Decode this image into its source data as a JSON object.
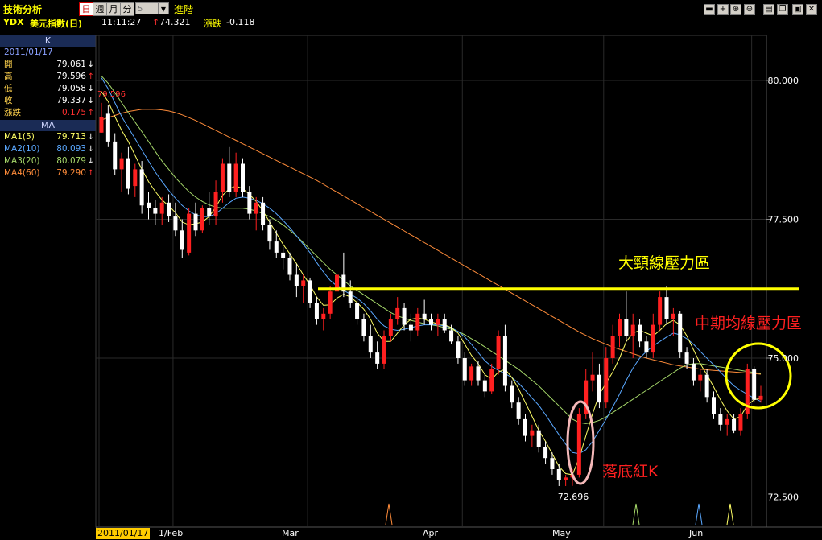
{
  "window": {
    "title": "技術分析",
    "period_buttons": [
      "日",
      "週",
      "月",
      "分"
    ],
    "period_select_value": "5",
    "advanced_label": "進階",
    "controls": [
      "minimize",
      "plus",
      "zoom-in",
      "zoom-out",
      "screenshot",
      "restore",
      "close"
    ]
  },
  "infobar": {
    "code": "YDX",
    "name": "美元指數(日)",
    "time": "11:11:27",
    "price_arrow": "↑",
    "price": "74.321",
    "change_label": "漲跌",
    "change": "-0.118"
  },
  "panel": {
    "k_header": "K",
    "date": "2011/01/17",
    "rows": [
      {
        "label": "開",
        "value": "79.061",
        "arrow": "↓",
        "color": "#ffffff"
      },
      {
        "label": "高",
        "value": "79.596",
        "arrow": "↑",
        "color": "#ffffff"
      },
      {
        "label": "低",
        "value": "79.058",
        "arrow": "↓",
        "color": "#ffffff"
      },
      {
        "label": "收",
        "value": "79.337",
        "arrow": "↓",
        "color": "#ffffff"
      },
      {
        "label": "漲跌",
        "value": "0.175",
        "arrow": "↑",
        "color": "#ff3030"
      }
    ],
    "ma_header": "MA",
    "ma_rows": [
      {
        "label": "MA1(5)",
        "value": "79.713",
        "arrow": "↓",
        "color": "#ffff66"
      },
      {
        "label": "MA2(10)",
        "value": "80.093",
        "arrow": "↓",
        "color": "#5aa8ff"
      },
      {
        "label": "MA3(20)",
        "value": "80.079",
        "arrow": "↓",
        "color": "#a6d86a"
      },
      {
        "label": "MA4(60)",
        "value": "79.290",
        "arrow": "↑",
        "color": "#ff8c3a"
      }
    ]
  },
  "annotations": {
    "neckline": "大頸線壓力區",
    "mid_ma": "中期均線壓力區",
    "bottom_red_k": "落底紅K",
    "low_value": "72.696",
    "high_marker_value": "79.596"
  },
  "chart_data": {
    "type": "candlestick",
    "ylim": [
      72.0,
      81.3
    ],
    "y_ticks": [
      72.5,
      75.0,
      77.5,
      80.0
    ],
    "y_tick_labels": [
      "72.500",
      "75.000",
      "77.500",
      "80.000"
    ],
    "x_tick_labels": [
      "2011/01/17",
      "1/Feb",
      "Mar",
      "Apr",
      "May",
      "Jun"
    ],
    "x_tick_index": [
      0,
      11,
      31,
      54,
      75,
      97
    ],
    "colors": {
      "up": "#ff2020",
      "down": "#ffffff",
      "ma5": "#ffff66",
      "ma10": "#5aa8ff",
      "ma20": "#a6d86a",
      "ma60": "#ff8c3a",
      "neckline": "#ffff00"
    },
    "candles": [
      [
        79.061,
        79.596,
        79.058,
        79.337
      ],
      [
        79.4,
        79.55,
        78.8,
        78.9
      ],
      [
        78.9,
        79.05,
        78.3,
        78.4
      ],
      [
        78.4,
        78.7,
        78.0,
        78.6
      ],
      [
        78.6,
        78.8,
        77.95,
        78.05
      ],
      [
        78.1,
        78.5,
        77.9,
        78.4
      ],
      [
        78.4,
        78.55,
        77.6,
        77.75
      ],
      [
        77.8,
        78.0,
        77.5,
        77.7
      ],
      [
        77.7,
        77.85,
        77.4,
        77.6
      ],
      [
        77.6,
        77.9,
        77.4,
        77.8
      ],
      [
        77.8,
        77.95,
        77.45,
        77.55
      ],
      [
        77.55,
        77.8,
        77.2,
        77.3
      ],
      [
        77.3,
        77.5,
        76.8,
        76.95
      ],
      [
        76.9,
        77.7,
        76.85,
        77.6
      ],
      [
        77.6,
        77.8,
        77.2,
        77.3
      ],
      [
        77.3,
        77.75,
        77.25,
        77.7
      ],
      [
        77.7,
        78.0,
        77.4,
        77.55
      ],
      [
        77.55,
        78.2,
        77.4,
        78.0
      ],
      [
        78.0,
        78.6,
        77.8,
        78.5
      ],
      [
        78.5,
        78.8,
        77.9,
        78.0
      ],
      [
        78.0,
        78.7,
        77.9,
        78.5
      ],
      [
        78.5,
        78.6,
        77.9,
        78.0
      ],
      [
        78.0,
        78.1,
        77.5,
        77.6
      ],
      [
        77.6,
        77.9,
        77.3,
        77.8
      ],
      [
        77.8,
        77.9,
        77.3,
        77.4
      ],
      [
        77.4,
        77.5,
        76.95,
        77.1
      ],
      [
        77.1,
        77.3,
        76.8,
        76.9
      ],
      [
        76.9,
        77.0,
        76.6,
        76.8
      ],
      [
        76.8,
        76.9,
        76.4,
        76.5
      ],
      [
        76.5,
        76.7,
        76.1,
        76.3
      ],
      [
        76.3,
        76.5,
        76.0,
        76.4
      ],
      [
        76.4,
        76.45,
        75.9,
        76.0
      ],
      [
        76.0,
        76.1,
        75.6,
        75.7
      ],
      [
        75.7,
        75.9,
        75.5,
        75.8
      ],
      [
        75.8,
        76.3,
        75.7,
        76.2
      ],
      [
        76.2,
        76.7,
        76.0,
        76.5
      ],
      [
        76.5,
        76.9,
        76.1,
        76.2
      ],
      [
        76.2,
        76.4,
        75.9,
        76.0
      ],
      [
        76.0,
        76.1,
        75.6,
        75.7
      ],
      [
        75.7,
        75.8,
        75.3,
        75.4
      ],
      [
        75.4,
        75.6,
        75.0,
        75.1
      ],
      [
        75.1,
        75.3,
        74.8,
        74.9
      ],
      [
        74.9,
        75.5,
        74.8,
        75.4
      ],
      [
        75.4,
        75.8,
        75.3,
        75.7
      ],
      [
        75.7,
        76.1,
        75.6,
        75.9
      ],
      [
        75.9,
        76.0,
        75.5,
        75.6
      ],
      [
        75.6,
        75.8,
        75.3,
        75.5
      ],
      [
        75.5,
        75.9,
        75.4,
        75.8
      ],
      [
        75.8,
        76.05,
        75.6,
        75.7
      ],
      [
        75.7,
        75.8,
        75.5,
        75.6
      ],
      [
        75.6,
        75.8,
        75.4,
        75.7
      ],
      [
        75.7,
        75.8,
        75.45,
        75.5
      ],
      [
        75.5,
        75.6,
        75.25,
        75.3
      ],
      [
        75.3,
        75.4,
        74.9,
        75.0
      ],
      [
        75.0,
        75.1,
        74.5,
        74.6
      ],
      [
        74.6,
        74.9,
        74.5,
        74.85
      ],
      [
        74.85,
        74.95,
        74.5,
        74.6
      ],
      [
        74.6,
        74.7,
        74.3,
        74.4
      ],
      [
        74.4,
        74.9,
        74.35,
        74.8
      ],
      [
        74.8,
        75.5,
        74.7,
        75.4
      ],
      [
        75.4,
        75.6,
        74.4,
        74.5
      ],
      [
        74.5,
        74.6,
        74.1,
        74.2
      ],
      [
        74.2,
        74.3,
        73.8,
        73.9
      ],
      [
        73.9,
        74.0,
        73.5,
        73.6
      ],
      [
        73.6,
        73.8,
        73.4,
        73.7
      ],
      [
        73.7,
        73.8,
        73.3,
        73.4
      ],
      [
        73.4,
        73.5,
        73.1,
        73.2
      ],
      [
        73.2,
        73.3,
        72.9,
        73.0
      ],
      [
        73.0,
        73.1,
        72.696,
        72.8
      ],
      [
        72.8,
        72.9,
        72.696,
        72.85
      ],
      [
        72.85,
        73.0,
        72.7,
        72.9
      ],
      [
        72.9,
        74.1,
        72.85,
        74.0
      ],
      [
        74.0,
        74.8,
        73.9,
        74.6
      ],
      [
        74.6,
        75.1,
        74.4,
        74.7
      ],
      [
        74.7,
        74.9,
        74.1,
        74.2
      ],
      [
        74.2,
        75.2,
        74.1,
        75.0
      ],
      [
        75.0,
        75.6,
        74.9,
        75.4
      ],
      [
        75.4,
        75.8,
        75.2,
        75.7
      ],
      [
        75.7,
        76.2,
        75.3,
        75.4
      ],
      [
        75.4,
        75.8,
        75.0,
        75.6
      ],
      [
        75.6,
        75.7,
        75.2,
        75.3
      ],
      [
        75.3,
        75.4,
        75.0,
        75.1
      ],
      [
        75.1,
        75.8,
        75.0,
        75.6
      ],
      [
        75.6,
        76.2,
        75.5,
        76.1
      ],
      [
        76.1,
        76.3,
        75.6,
        75.7
      ],
      [
        75.7,
        75.9,
        75.4,
        75.8
      ],
      [
        75.8,
        75.85,
        75.0,
        75.1
      ],
      [
        75.1,
        75.2,
        74.8,
        74.9
      ],
      [
        74.9,
        75.0,
        74.5,
        74.6
      ],
      [
        74.6,
        74.8,
        74.4,
        74.7
      ],
      [
        74.7,
        74.8,
        74.2,
        74.3
      ],
      [
        74.3,
        74.4,
        73.9,
        74.0
      ],
      [
        74.0,
        74.1,
        73.7,
        73.8
      ],
      [
        73.8,
        74.0,
        73.6,
        73.9
      ],
      [
        73.9,
        74.0,
        73.65,
        73.7
      ],
      [
        73.7,
        74.1,
        73.6,
        74.0
      ],
      [
        74.0,
        74.9,
        73.9,
        74.8
      ],
      [
        74.8,
        74.85,
        74.2,
        74.25
      ],
      [
        74.25,
        74.5,
        74.2,
        74.321
      ]
    ],
    "ma5": [
      79.8,
      79.62,
      79.35,
      79.1,
      78.9,
      78.65,
      78.4,
      78.18,
      78.0,
      77.85,
      77.74,
      77.62,
      77.45,
      77.4,
      77.42,
      77.45,
      77.55,
      77.72,
      77.93,
      78.05,
      78.1,
      78.05,
      77.95,
      77.82,
      77.65,
      77.45,
      77.25,
      77.05,
      76.88,
      76.7,
      76.5,
      76.32,
      76.1,
      75.95,
      75.96,
      76.08,
      76.15,
      76.1,
      76.0,
      75.88,
      75.7,
      75.45,
      75.3,
      75.3,
      75.45,
      75.6,
      75.7,
      75.72,
      75.7,
      75.65,
      75.62,
      75.6,
      75.55,
      75.45,
      75.25,
      75.05,
      74.9,
      74.7,
      74.62,
      74.75,
      74.8,
      74.65,
      74.45,
      74.2,
      73.95,
      73.7,
      73.5,
      73.28,
      73.05,
      72.92,
      72.9,
      73.2,
      73.6,
      74.0,
      74.35,
      74.55,
      74.75,
      75.0,
      75.3,
      75.45,
      75.5,
      75.45,
      75.4,
      75.5,
      75.62,
      75.68,
      75.6,
      75.4,
      75.15,
      74.9,
      74.7,
      74.48,
      74.25,
      74.05,
      73.9,
      73.95,
      74.15,
      74.25,
      74.28
    ],
    "ma10": [
      80.05,
      79.85,
      79.6,
      79.35,
      79.15,
      78.95,
      78.75,
      78.55,
      78.35,
      78.18,
      78.02,
      77.88,
      77.75,
      77.65,
      77.58,
      77.55,
      77.55,
      77.6,
      77.7,
      77.8,
      77.88,
      77.9,
      77.88,
      77.84,
      77.78,
      77.7,
      77.6,
      77.48,
      77.35,
      77.2,
      77.05,
      76.9,
      76.72,
      76.55,
      76.4,
      76.3,
      76.22,
      76.15,
      76.08,
      75.98,
      75.85,
      75.7,
      75.58,
      75.52,
      75.5,
      75.52,
      75.55,
      75.58,
      75.6,
      75.6,
      75.6,
      75.58,
      75.55,
      75.48,
      75.38,
      75.25,
      75.1,
      74.95,
      74.85,
      74.78,
      74.72,
      74.65,
      74.55,
      74.42,
      74.28,
      74.15,
      73.98,
      73.8,
      73.62,
      73.45,
      73.3,
      73.28,
      73.35,
      73.5,
      73.7,
      73.9,
      74.12,
      74.35,
      74.6,
      74.82,
      75.0,
      75.12,
      75.22,
      75.3,
      75.38,
      75.45,
      75.42,
      75.35,
      75.25,
      75.12,
      75.0,
      74.88,
      74.75,
      74.62,
      74.5,
      74.42,
      74.35,
      74.28,
      74.22
    ],
    "ma20": [
      80.08,
      79.95,
      79.78,
      79.6,
      79.42,
      79.25,
      79.08,
      78.9,
      78.72,
      78.55,
      78.4,
      78.25,
      78.12,
      78.0,
      77.9,
      77.82,
      77.76,
      77.72,
      77.7,
      77.7,
      77.7,
      77.7,
      77.68,
      77.65,
      77.6,
      77.55,
      77.48,
      77.4,
      77.3,
      77.2,
      77.08,
      76.96,
      76.84,
      76.72,
      76.6,
      76.5,
      76.4,
      76.3,
      76.22,
      76.14,
      76.06,
      75.98,
      75.9,
      75.82,
      75.76,
      75.72,
      75.68,
      75.65,
      75.62,
      75.6,
      75.58,
      75.55,
      75.52,
      75.48,
      75.42,
      75.35,
      75.28,
      75.2,
      75.12,
      75.04,
      74.96,
      74.88,
      74.8,
      74.7,
      74.6,
      74.5,
      74.38,
      74.26,
      74.14,
      74.02,
      73.9,
      73.84,
      73.82,
      73.84,
      73.88,
      73.94,
      74.02,
      74.1,
      74.18,
      74.26,
      74.34,
      74.42,
      74.5,
      74.58,
      74.66,
      74.74,
      74.82,
      74.88,
      74.9,
      74.9,
      74.88,
      74.86,
      74.84,
      74.82,
      74.8,
      74.78,
      74.76,
      74.74,
      74.72
    ],
    "ma60": [
      79.29,
      79.33,
      79.37,
      79.41,
      79.44,
      79.46,
      79.48,
      79.48,
      79.48,
      79.47,
      79.45,
      79.42,
      79.38,
      79.33,
      79.28,
      79.22,
      79.16,
      79.1,
      79.04,
      78.98,
      78.92,
      78.86,
      78.8,
      78.74,
      78.68,
      78.62,
      78.56,
      78.5,
      78.44,
      78.38,
      78.32,
      78.26,
      78.2,
      78.13,
      78.06,
      77.99,
      77.92,
      77.85,
      77.78,
      77.71,
      77.64,
      77.57,
      77.5,
      77.43,
      77.36,
      77.29,
      77.22,
      77.15,
      77.08,
      77.01,
      76.94,
      76.87,
      76.8,
      76.73,
      76.66,
      76.59,
      76.52,
      76.45,
      76.38,
      76.31,
      76.24,
      76.17,
      76.1,
      76.03,
      75.96,
      75.89,
      75.82,
      75.75,
      75.68,
      75.61,
      75.54,
      75.47,
      75.41,
      75.35,
      75.3,
      75.25,
      75.2,
      75.16,
      75.12,
      75.08,
      75.04,
      75.0,
      74.97,
      74.94,
      74.91,
      74.88,
      74.86,
      74.84,
      74.82,
      74.8,
      74.79,
      74.78,
      74.77,
      74.76,
      74.75,
      74.74,
      74.73,
      74.72,
      74.71
    ],
    "neckline_value": 76.25,
    "marker_colors": [
      "#ff8c3a",
      "#a6d86a",
      "#5aa8ff",
      "#ffff66"
    ],
    "marker_index": [
      54,
      101,
      113,
      119
    ]
  }
}
